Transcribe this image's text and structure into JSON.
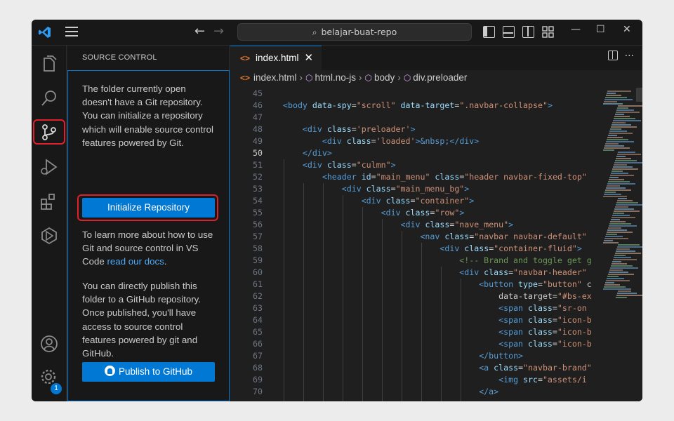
{
  "titlebar": {
    "search_text": "belajar-buat-repo",
    "back_arrow": "←",
    "forward_arrow": "→",
    "minimize": "—",
    "maximize": "☐",
    "close": "✕",
    "icons": [
      "vscode-logo-icon",
      "hamburger-menu-icon",
      "toggle-primary-sidebar-icon",
      "toggle-panel-icon",
      "toggle-secondary-sidebar-icon",
      "customize-layout-icon"
    ]
  },
  "activity_bar": {
    "items": [
      "explorer-icon",
      "search-icon",
      "source-control-icon",
      "run-debug-icon",
      "extensions-icon",
      "remote-explorer-icon"
    ],
    "bottom": [
      "accounts-icon",
      "manage-gear-icon"
    ],
    "settings_badge": "1"
  },
  "sidebar": {
    "title": "SOURCE CONTROL",
    "para1": "The folder currently open doesn't have a Git repository. You can initialize a repository which will enable source control features powered by Git.",
    "init_button": "Initialize Repository",
    "para2_before": "To learn more about how to use Git and source control in VS Code ",
    "para2_link": "read our docs",
    "para2_after": ".",
    "para3": "You can directly publish this folder to a GitHub repository. Once published, you'll have access to source control features powered by git and GitHub.",
    "publish_button": "Publish to GitHub"
  },
  "editor": {
    "tab_label": "index.html",
    "tab_icon": "<>",
    "tab_close": "✕",
    "breadcrumbs": [
      "index.html",
      "html.no-js",
      "body",
      "div.preloader"
    ],
    "current_line": "50",
    "lines": [
      {
        "n": "45",
        "code": ""
      },
      {
        "n": "46",
        "code": "<body data-spy=\"scroll\" data-target=\".navbar-collapse\">"
      },
      {
        "n": "47",
        "code": ""
      },
      {
        "n": "48",
        "code": "    <div class='preloader'>"
      },
      {
        "n": "49",
        "code": "        <div class='loaded'>&nbsp;</div>"
      },
      {
        "n": "50",
        "code": "    </div>"
      },
      {
        "n": "51",
        "code": "    <div class=\"culmn\">"
      },
      {
        "n": "52",
        "code": "        <header id=\"main_menu\" class=\"header navbar-fixed-top\""
      },
      {
        "n": "53",
        "code": "            <div class=\"main_menu_bg\">"
      },
      {
        "n": "54",
        "code": "                <div class=\"container\">"
      },
      {
        "n": "55",
        "code": "                    <div class=\"row\">"
      },
      {
        "n": "56",
        "code": "                        <div class=\"nave_menu\">"
      },
      {
        "n": "57",
        "code": "                            <nav class=\"navbar navbar-default\""
      },
      {
        "n": "58",
        "code": "                                <div class=\"container-fluid\">"
      },
      {
        "n": "59",
        "code": "                                    <!-- Brand and toggle get g"
      },
      {
        "n": "60",
        "code": "                                    <div class=\"navbar-header\""
      },
      {
        "n": "61",
        "code": "                                        <button type=\"button\" c"
      },
      {
        "n": "62",
        "code": "                                            data-target=\"#bs-ex"
      },
      {
        "n": "63",
        "code": "                                            <span class=\"sr-on"
      },
      {
        "n": "64",
        "code": "                                            <span class=\"icon-b"
      },
      {
        "n": "65",
        "code": "                                            <span class=\"icon-b"
      },
      {
        "n": "66",
        "code": "                                            <span class=\"icon-b"
      },
      {
        "n": "67",
        "code": "                                        </button>"
      },
      {
        "n": "68",
        "code": "                                        <a class=\"navbar-brand\""
      },
      {
        "n": "69",
        "code": "                                            <img src=\"assets/i"
      },
      {
        "n": "70",
        "code": "                                        </a>"
      }
    ]
  },
  "colors": {
    "accent": "#0078d4",
    "highlight_outline": "#e0202a",
    "tag": "#569cd6",
    "attr": "#9cdcfe",
    "string": "#ce9178",
    "comment": "#6a9955"
  }
}
